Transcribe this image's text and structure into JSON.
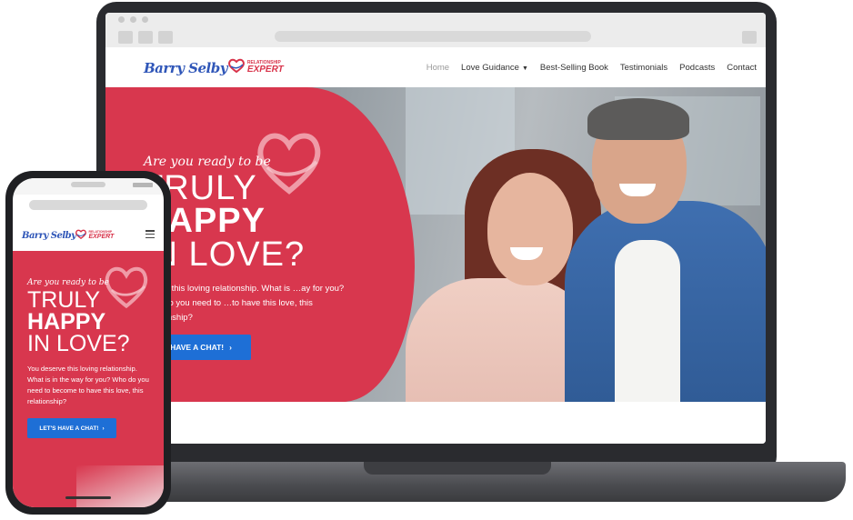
{
  "brand": {
    "name": "Barry Selby",
    "tagline_top": "RELATIONSHIP",
    "tagline_bottom": "EXPERT",
    "accent_red": "#d8374e",
    "accent_blue": "#1e6fd6"
  },
  "nav": {
    "items": [
      {
        "label": "Home",
        "active": true
      },
      {
        "label": "Love Guidance",
        "has_dropdown": true
      },
      {
        "label": "Best-Selling Book"
      },
      {
        "label": "Testimonials"
      },
      {
        "label": "Podcasts"
      },
      {
        "label": "Contact"
      }
    ],
    "dropdown_icon": "chevron-down-icon"
  },
  "hero": {
    "pretitle": "Are you ready to be",
    "line1": "TRULY",
    "line2": "HAPPY",
    "line3": "IN LOVE?",
    "body_desktop": "…erve this loving relationship. What is …ay for you? Who do you need to …to have this love, this relationship?",
    "body": "You deserve this loving relationship. What is in the way for you? Who do you need to become to have this love, this relationship?",
    "cta_desktop": "'S HAVE A CHAT!",
    "cta": "LET'S HAVE A CHAT!",
    "cta_icon": "chevron-right-icon",
    "heart_icon": "heart-icon"
  },
  "mobile": {
    "menu_icon": "hamburger-menu-icon"
  }
}
